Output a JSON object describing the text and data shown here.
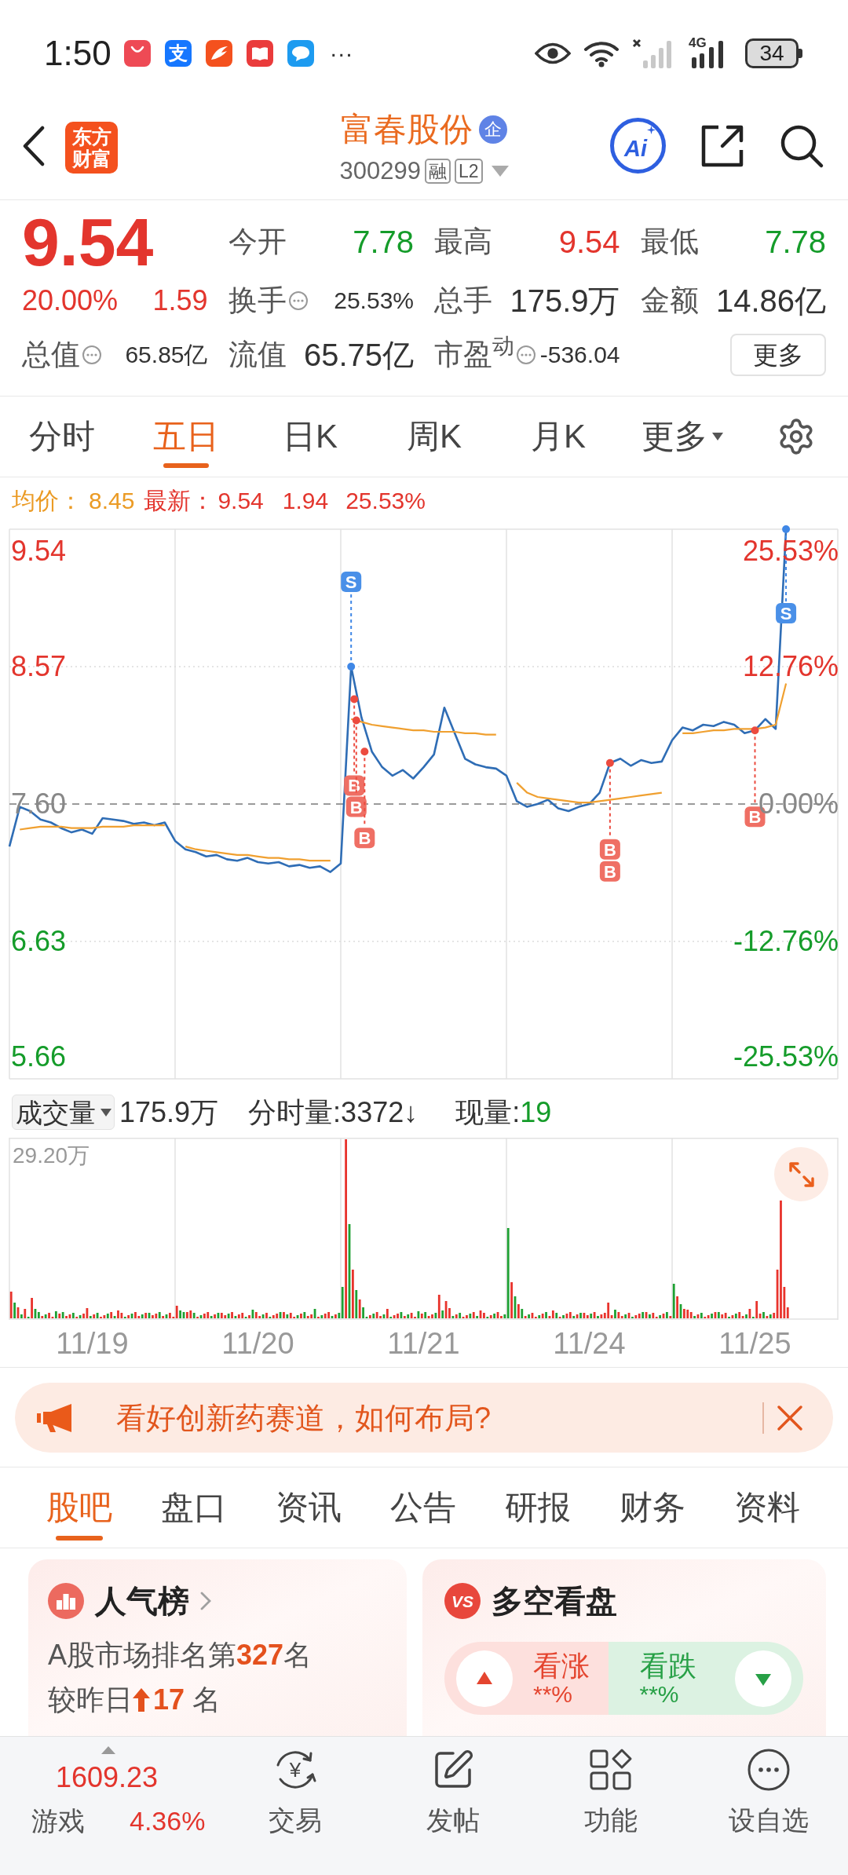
{
  "status_bar": {
    "time": "1:50",
    "notifications": [
      {
        "kind": "appgallery"
      },
      {
        "kind": "alipay",
        "glyph": "支"
      },
      {
        "kind": "news"
      },
      {
        "kind": "book"
      },
      {
        "kind": "chat"
      }
    ],
    "more": "···",
    "network": "4G",
    "battery": "34"
  },
  "header": {
    "logo_text": "东方财富",
    "title": "富春股份",
    "title_badge": "企",
    "code": "300299",
    "tags": [
      "融",
      "L2"
    ],
    "ai_label": "Ai"
  },
  "quote": {
    "price": "9.54",
    "change_pct": "20.00%",
    "change": "1.59",
    "rising": true,
    "stats": [
      {
        "label": "今开",
        "value": "7.78",
        "color": "#159c2a",
        "info": false
      },
      {
        "label": "最高",
        "value": "9.54",
        "color": "#e3352d",
        "info": false
      },
      {
        "label": "最低",
        "value": "7.78",
        "color": "#159c2a",
        "info": false
      },
      {
        "label": "换手",
        "value": "25.53%",
        "info": true
      },
      {
        "label": "总手",
        "value": "175.9万",
        "info": false
      },
      {
        "label": "金额",
        "value": "14.86亿",
        "info": false
      },
      {
        "label": "总值",
        "value": "65.85亿",
        "info": true
      },
      {
        "label": "流值",
        "value": "65.75亿",
        "info": false
      },
      {
        "label": "市盈$^{动}$",
        "value": "-536.04",
        "info": true
      }
    ],
    "more_button": "更多"
  },
  "chart_tabs": [
    {
      "label": "分时",
      "kind": "tab",
      "selected": false
    },
    {
      "label": "五日",
      "kind": "tab",
      "selected": true
    },
    {
      "label": "日K",
      "kind": "tab",
      "selected": false
    },
    {
      "label": "周K",
      "kind": "tab",
      "selected": false
    },
    {
      "label": "月K",
      "kind": "tab",
      "selected": false
    },
    {
      "label": "更多",
      "kind": "menu",
      "selected": false
    }
  ],
  "chart_info": {
    "avg_label": "均价：",
    "avg": "8.45",
    "last_label": "最新：",
    "last": "9.54",
    "change": "1.94",
    "change_pct": "25.53%",
    "rising": true
  },
  "price_chart": {
    "percent_ticks": [
      "25.53%",
      "12.76%",
      "0.00%",
      "-12.76%",
      "-25.53%"
    ],
    "signals": [
      {
        "kind": "sell",
        "label": "S"
      },
      {
        "kind": "buy",
        "label": "B"
      },
      {
        "kind": "buy",
        "label": "B"
      },
      {
        "kind": "buy",
        "label": "B"
      },
      {
        "kind": "buy",
        "label": "B"
      },
      {
        "kind": "buy",
        "label": "B"
      },
      {
        "kind": "buy",
        "label": "B"
      },
      {
        "kind": "sell",
        "label": "S"
      }
    ],
    "chart_data": {
      "type": "line",
      "grid": true,
      "categories": [
        null,
        null,
        null,
        null,
        null,
        null,
        null,
        null,
        null,
        null,
        null,
        null,
        null,
        null,
        null,
        null,
        null,
        null,
        null,
        null,
        null,
        null,
        null,
        null,
        null,
        null,
        null,
        null,
        null,
        null,
        null,
        null,
        null,
        null,
        null,
        null,
        null,
        null,
        null,
        null,
        null,
        null,
        null,
        null,
        null,
        null,
        null,
        null,
        null,
        null,
        null,
        null,
        null,
        null,
        null,
        null,
        null,
        null,
        null,
        null,
        null,
        null,
        null,
        null,
        null,
        null,
        null,
        null,
        null,
        null,
        null,
        null,
        null,
        null,
        null,
        null,
        null,
        null,
        null,
        null
      ],
      "ylim": [
        5.66,
        9.54
      ],
      "yticks": [
        {
          "value": 9.54,
          "label": "9.54"
        },
        {
          "value": 8.57,
          "label": "8.57"
        },
        {
          "value": 7.6,
          "label": "7.60"
        },
        {
          "value": 6.63,
          "label": "6.63"
        },
        {
          "value": 5.66,
          "label": "5.66"
        }
      ],
      "ref_lines": [
        {
          "axis": "y",
          "value": 7.6
        }
      ],
      "series": [
        {
          "color": "#2f6db5",
          "values": [
            7.3,
            7.58,
            7.55,
            7.49,
            7.47,
            7.43,
            7.4,
            7.42,
            7.39,
            7.5,
            7.49,
            7.48,
            7.46,
            7.47,
            7.45,
            7.47,
            7.34,
            7.28,
            7.26,
            7.23,
            7.24,
            7.21,
            7.2,
            7.22,
            7.19,
            7.18,
            7.19,
            7.16,
            7.17,
            7.15,
            7.16,
            7.12,
            7.18,
            8.57,
            8.21,
            7.97,
            7.86,
            7.8,
            7.84,
            7.78,
            7.86,
            7.95,
            8.28,
            8.1,
            7.92,
            7.88,
            7.86,
            7.85,
            7.8,
            7.62,
            7.58,
            7.6,
            7.63,
            7.57,
            7.55,
            7.58,
            7.6,
            7.68,
            7.89,
            7.92,
            7.87,
            7.91,
            7.89,
            7.9,
            8.05,
            8.14,
            8.12,
            8.16,
            8.15,
            8.18,
            8.16,
            8.1,
            8.12,
            8.2,
            8.13,
            9.54,
            null,
            null,
            null,
            null
          ]
        },
        {
          "color": "#f0a030",
          "values": [
            null,
            7.42,
            7.43,
            7.44,
            7.44,
            7.44,
            7.43,
            7.43,
            7.43,
            7.44,
            7.44,
            7.44,
            7.45,
            7.45,
            7.45,
            7.45,
            null,
            7.3,
            7.28,
            7.27,
            7.26,
            7.25,
            7.24,
            7.24,
            7.23,
            7.22,
            7.22,
            7.21,
            7.21,
            7.2,
            7.2,
            7.2,
            null,
            8.2,
            8.18,
            8.16,
            8.15,
            8.14,
            8.13,
            8.12,
            8.12,
            8.11,
            8.11,
            8.11,
            8.1,
            8.1,
            8.09,
            8.09,
            null,
            7.75,
            7.68,
            7.65,
            7.64,
            7.63,
            7.62,
            7.61,
            7.61,
            7.62,
            7.63,
            7.64,
            7.65,
            7.66,
            7.67,
            7.68,
            null,
            8.1,
            8.1,
            8.11,
            8.12,
            8.12,
            8.13,
            8.13,
            8.13,
            8.14,
            8.16,
            8.45,
            null,
            null,
            null,
            null
          ]
        }
      ]
    }
  },
  "volume": {
    "selector": "成交量",
    "total": "175.9万",
    "items": [
      {
        "label": "分时量:",
        "value": "3372↓"
      },
      {
        "label": "现量:",
        "value": "19",
        "color": "#159c2a"
      }
    ],
    "max_label": "29.20万",
    "dates": [
      "11/19",
      "11/20",
      "11/21",
      "11/24",
      "11/25"
    ]
  },
  "banner": {
    "text": "看好创新药赛道，如何布局?"
  },
  "section_tabs": [
    {
      "label": "股吧",
      "selected": true
    },
    {
      "label": "盘口",
      "selected": false
    },
    {
      "label": "资讯",
      "selected": false
    },
    {
      "label": "公告",
      "selected": false
    },
    {
      "label": "研报",
      "selected": false
    },
    {
      "label": "财务",
      "selected": false
    },
    {
      "label": "资料",
      "selected": false
    }
  ],
  "popularity_card": {
    "title": "人气榜",
    "rank_text": "A股市场排名第**327**名",
    "change_prefix": "较昨日",
    "rising": true,
    "change_text": "**17** 名"
  },
  "sentiment_card": {
    "badge": "VS",
    "title": "多空看盘",
    "options": [
      {
        "kind": "bull",
        "label": "看涨",
        "value": "**%"
      },
      {
        "kind": "bear",
        "label": "看跌",
        "value": "**%"
      }
    ]
  },
  "bottom_nav": {
    "index": {
      "value": "1609.23",
      "name": "游戏",
      "change": "4.36%",
      "rising": true
    },
    "items": [
      {
        "label": "交易",
        "kind": "trade",
        "glyph": "¥"
      },
      {
        "label": "发帖",
        "kind": "post"
      },
      {
        "label": "功能",
        "kind": "apps"
      },
      {
        "label": "设自选",
        "kind": "more"
      }
    ]
  }
}
